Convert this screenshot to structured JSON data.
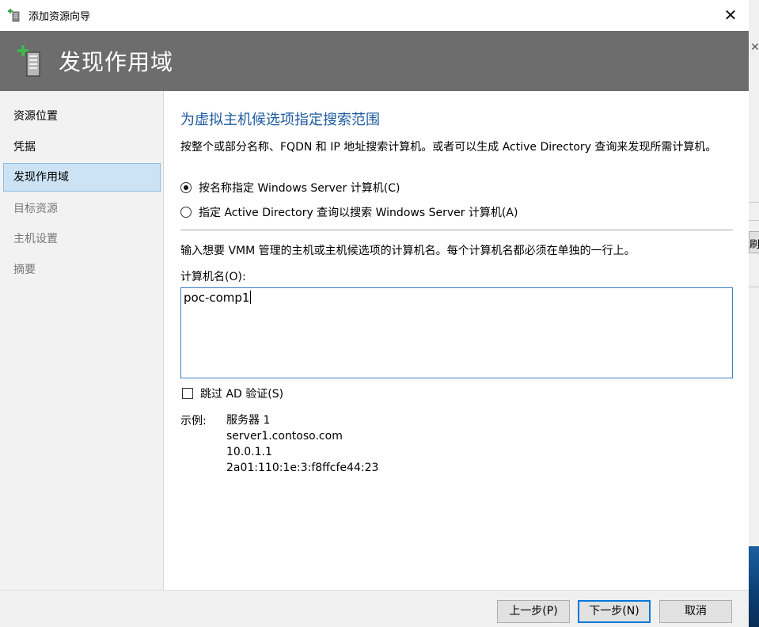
{
  "window": {
    "title": "添加资源向导",
    "close_glyph": "✕"
  },
  "header": {
    "title": "发现作用域",
    "icon": "server-add-icon"
  },
  "sidebar": {
    "items": [
      {
        "label": "资源位置",
        "state": "normal"
      },
      {
        "label": "凭据",
        "state": "normal"
      },
      {
        "label": "发现作用域",
        "state": "active"
      },
      {
        "label": "目标资源",
        "state": "disabled"
      },
      {
        "label": "主机设置",
        "state": "disabled"
      },
      {
        "label": "摘要",
        "state": "disabled"
      }
    ]
  },
  "main": {
    "section_title": "为虚拟主机候选项指定搜索范围",
    "description": "按整个或部分名称、FQDN 和 IP 地址搜索计算机。或者可以生成 Active Directory 查询来发现所需计算机。",
    "radio_by_name": "按名称指定 Windows Server 计算机(C)",
    "radio_by_ad": "指定 Active Directory 查询以搜索 Windows Server 计算机(A)",
    "selected_radio": "by_name",
    "instruction": "输入想要 VMM 管理的主机或主机候选项的计算机名。每个计算机名都必须在单独的一行上。",
    "computer_names_label": "计算机名(O):",
    "computer_names_value": "poc-comp1",
    "skip_ad_label": "跳过 AD 验证(S)",
    "skip_ad_checked": false,
    "example_label": "示例:",
    "examples": [
      "服务器 1",
      "server1.contoso.com",
      "10.0.1.1",
      "2a01:110:1e:3:f8ffcfe44:23"
    ]
  },
  "footer": {
    "prev_label": "上一步(P)",
    "next_label": "下一步(N)",
    "cancel_label": "取消"
  },
  "background": {
    "partial_button_text": "刷"
  },
  "colors": {
    "header_bg": "#6d6d6d",
    "section_title": "#1e5aa0",
    "active_nav_bg": "#cce3f5",
    "focus_border": "#0078d7"
  }
}
